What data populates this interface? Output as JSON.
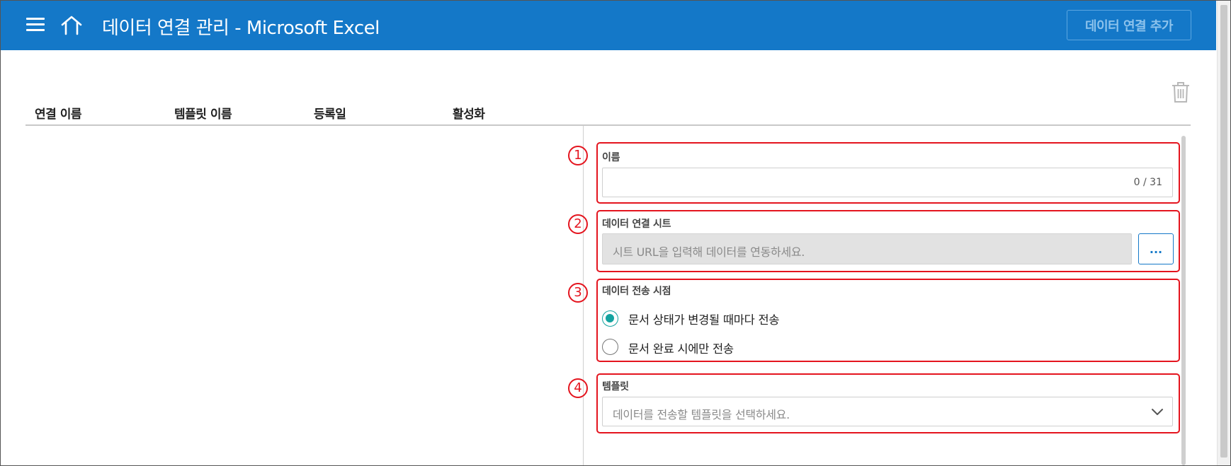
{
  "header": {
    "title": "데이터 연결 관리 - Microsoft Excel",
    "add_button_label": "데이터 연결 추가",
    "menu_icon": "hamburger-menu-icon",
    "home_icon": "home-icon"
  },
  "toolbar": {
    "delete_icon": "trash-icon"
  },
  "table": {
    "columns": [
      "연결 이름",
      "템플릿 이름",
      "등록일",
      "활성화"
    ],
    "rows": []
  },
  "form": {
    "markers": [
      "1",
      "2",
      "3",
      "4"
    ],
    "name": {
      "label": "이름",
      "value": "",
      "counter": "0 / 31"
    },
    "sheet": {
      "label": "데이터 연결 시트",
      "placeholder": "시트 URL을 입력해 데이터를 연동하세요.",
      "browse_label": "..."
    },
    "timing": {
      "label": "데이터 전송 시점",
      "options": [
        {
          "label": "문서 상태가 변경될 때마다 전송",
          "selected": true
        },
        {
          "label": "문서 완료 시에만 전송",
          "selected": false
        }
      ]
    },
    "template": {
      "label": "템플릿",
      "placeholder": "데이터를 전송할 템플릿을 선택하세요."
    }
  },
  "colors": {
    "header_bg": "#1478c8",
    "highlight": "#e4141e",
    "radio_selected": "#14a3a0"
  }
}
